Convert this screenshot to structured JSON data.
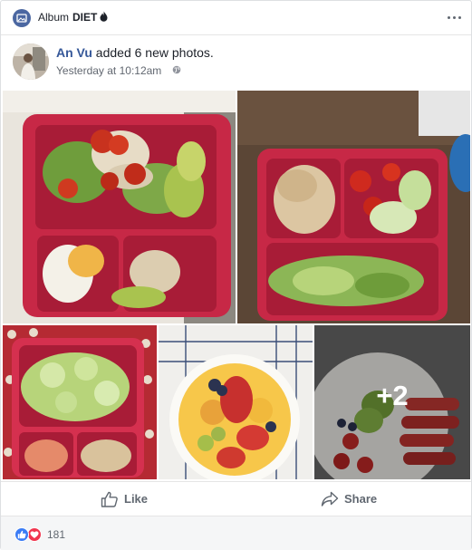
{
  "album": {
    "prefix": "Album",
    "name": "DIET"
  },
  "post": {
    "author": "An Vu",
    "action_text": " added 6 new photos.",
    "timestamp": "Yesterday at 10:12am",
    "visibility_icon": "globe-icon"
  },
  "photos": {
    "items": [
      {
        "description": "red lunch box with salad, tomato, chicken, avocado and egg"
      },
      {
        "description": "red lunch box with chicken, tomatoes, cucumber and salad on wooden table"
      },
      {
        "description": "red lunch box with cucumber salad and shrimp"
      },
      {
        "description": "bowl of fruit with strawberries, mango, avocado and blueberries"
      },
      {
        "description": "plate of fruit with kiwi and strawberries"
      }
    ],
    "more_count": "+2"
  },
  "actions": {
    "like_label": "Like",
    "share_label": "Share"
  },
  "reactions": {
    "count": "181",
    "types": [
      "like",
      "love"
    ]
  },
  "colors": {
    "link": "#365899",
    "like_reaction": "#3b7cf5",
    "love_reaction": "#f0364f",
    "lunchbox_red": "#c72846"
  }
}
